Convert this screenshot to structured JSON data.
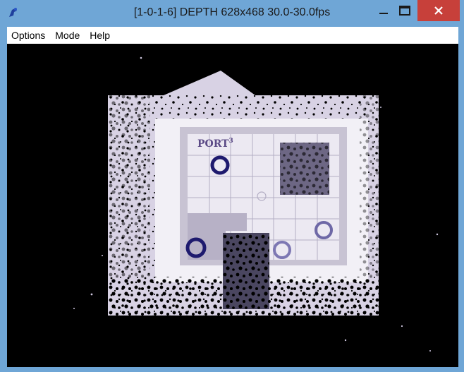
{
  "window": {
    "title": "[1-0-1-6] DEPTH 628x468 30.0-30.0fps",
    "icon": "viewer-app-icon"
  },
  "window_controls": {
    "minimize": "minimize-icon",
    "maximize": "maximize-icon",
    "close": "close-icon"
  },
  "menu": {
    "items": [
      {
        "label": "Options"
      },
      {
        "label": "Mode"
      },
      {
        "label": "Help"
      }
    ]
  },
  "viewport": {
    "sign_text": "PORT",
    "sign_superscript": "3"
  },
  "colors": {
    "title_bar": "#6fa6d6",
    "close_button": "#c7403a",
    "viewport_bg": "#000000",
    "depth_surface": "#d9d2e6"
  }
}
